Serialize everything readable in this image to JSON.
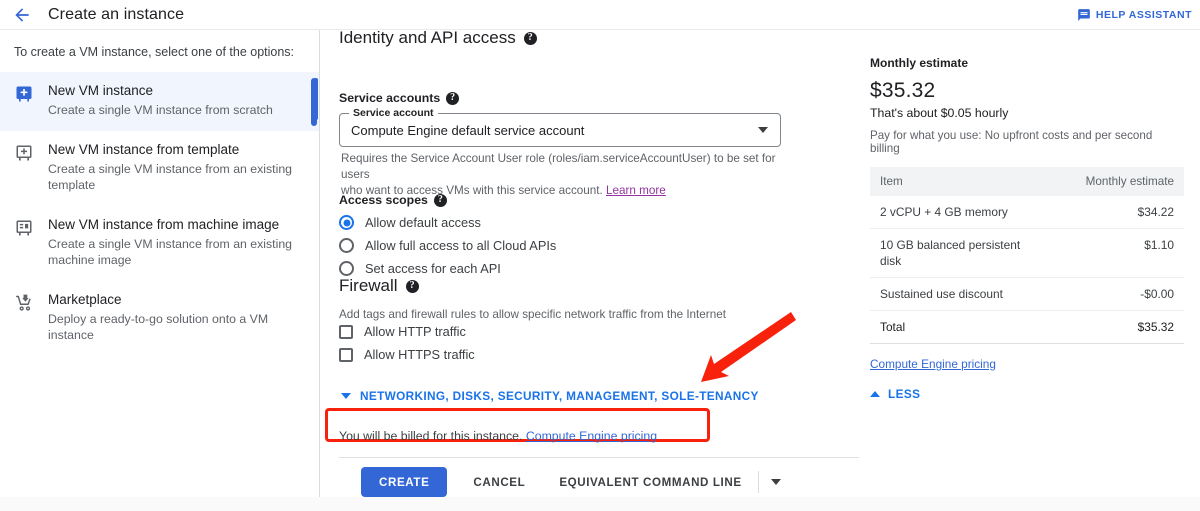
{
  "header": {
    "back_icon": "arrow-left-icon",
    "title": "Create an instance",
    "help_assistant_label": "HELP ASSISTANT",
    "help_assistant_icon": "comment-icon"
  },
  "sidebar": {
    "intro": "To create a VM instance, select one of the options:",
    "items": [
      {
        "icon": "vm-instance-add-icon",
        "title": "New VM instance",
        "desc": "Create a single VM instance from scratch",
        "selected": true
      },
      {
        "icon": "vm-template-add-icon",
        "title": "New VM instance from template",
        "desc": "Create a single VM instance from an existing template",
        "selected": false
      },
      {
        "icon": "machine-image-icon",
        "title": "New VM instance from machine image",
        "desc": "Create a single VM instance from an existing machine image",
        "selected": false
      },
      {
        "icon": "marketplace-cart-icon",
        "title": "Marketplace",
        "desc": "Deploy a ready-to-go solution onto a VM instance",
        "selected": false
      }
    ]
  },
  "main": {
    "identity_section": {
      "heading": "Identity and API access",
      "help_icon": "help-icon",
      "service_accounts_label": "Service accounts",
      "service_account_legend": "Service account",
      "service_account_value": "Compute Engine default service account",
      "dropdown_icon": "chevron-down-icon",
      "hint_line1": "Requires the Service Account User role (roles/iam.serviceAccountUser) to be set for users",
      "hint_line2": "who want to access VMs with this service account.",
      "learn_more": "Learn more"
    },
    "access_scopes": {
      "label": "Access scopes",
      "options": [
        {
          "label": "Allow default access",
          "selected": true
        },
        {
          "label": "Allow full access to all Cloud APIs",
          "selected": false
        },
        {
          "label": "Set access for each API",
          "selected": false
        }
      ]
    },
    "firewall": {
      "heading": "Firewall",
      "description": "Add tags and firewall rules to allow specific network traffic from the Internet",
      "checkboxes": [
        {
          "label": "Allow HTTP traffic",
          "checked": false
        },
        {
          "label": "Allow HTTPS traffic",
          "checked": false
        }
      ]
    },
    "advanced_toggle": {
      "label": "NETWORKING, DISKS, SECURITY, MANAGEMENT, SOLE-TENANCY",
      "icon": "chevron-down-icon",
      "highlight_color": "#f8210b"
    },
    "billing_note": {
      "text": "You will be billed for this instance.",
      "link": "Compute Engine pricing"
    },
    "actions": {
      "create_label": "CREATE",
      "cancel_label": "CANCEL",
      "equivalent_label": "EQUIVALENT COMMAND LINE",
      "caret_icon": "chevron-down-icon"
    }
  },
  "estimate": {
    "title": "Monthly estimate",
    "price": "$35.32",
    "hourly": "That's about $0.05 hourly",
    "note": "Pay for what you use: No upfront costs and per second billing",
    "columns": [
      "Item",
      "Monthly estimate"
    ],
    "rows": [
      {
        "item": "2 vCPU + 4 GB memory",
        "value": "$34.22",
        "style": "normal"
      },
      {
        "item": "10 GB balanced persistent disk",
        "value": "$1.10",
        "style": "normal"
      },
      {
        "item": "Sustained use discount",
        "value": "-$0.00",
        "style": "green"
      },
      {
        "item": "Total",
        "value": "$35.32",
        "style": "total"
      }
    ],
    "pricing_link": "Compute Engine pricing",
    "less_label": "LESS",
    "less_icon": "chevron-up-icon"
  },
  "colors": {
    "accent_blue": "#3367d6",
    "link_blue": "#1a73e8",
    "visited_purple": "#9334a0",
    "annotation_red": "#f8210b",
    "discount_green": "#137333"
  }
}
